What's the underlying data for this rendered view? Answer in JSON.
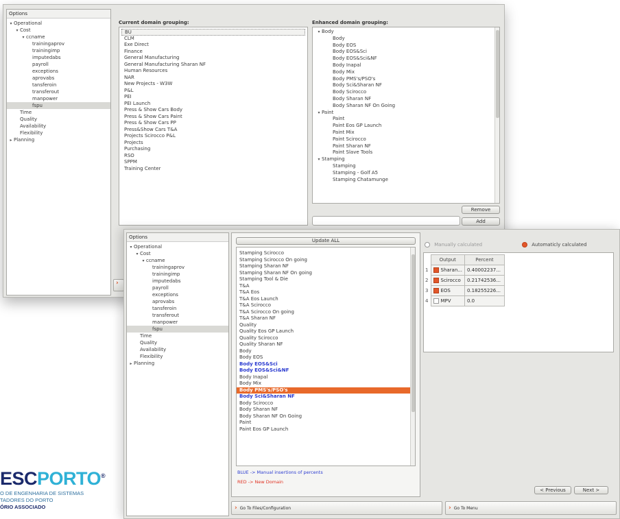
{
  "window_back": {
    "options_label": "Options",
    "tree": [
      {
        "label": "Operational",
        "level": 0,
        "expanded": true
      },
      {
        "label": "Cost",
        "level": 1,
        "expanded": true
      },
      {
        "label": "ccname",
        "level": 2,
        "expanded": true
      },
      {
        "label": "trainingaprov",
        "level": 3
      },
      {
        "label": "trainingimp",
        "level": 3
      },
      {
        "label": "imputedabs",
        "level": 3
      },
      {
        "label": "payroll",
        "level": 3
      },
      {
        "label": "exceptions",
        "level": 3
      },
      {
        "label": "aprovabs",
        "level": 3
      },
      {
        "label": "tansferoin",
        "level": 3
      },
      {
        "label": "transferout",
        "level": 3
      },
      {
        "label": "manpower",
        "level": 3
      },
      {
        "label": "fspu",
        "level": 3,
        "selected": true
      },
      {
        "label": "Time",
        "level": 1
      },
      {
        "label": "Quality",
        "level": 1
      },
      {
        "label": "Availability",
        "level": 1
      },
      {
        "label": "Flexibility",
        "level": 1
      },
      {
        "label": "Planning",
        "level": 0,
        "expanded": false
      }
    ],
    "current_label": "Current domain grouping:",
    "current_items": [
      "BU",
      "CLM",
      "Exe Direct",
      "Finance",
      "General Manufacturing",
      "General Manufacturing Sharan NF",
      "Human Resources",
      "NAR",
      "New Projects - W3W",
      "P&L",
      "PEI",
      "PEI Launch",
      "Press & Show Cars Body",
      "Press & Show Cars Paint",
      "Press & Show Cars PP",
      "Press&Show Cars T&A",
      "Projects Scirocco P&L",
      "Projects",
      "Purchasing",
      "RSO",
      "SPPM",
      "Training Center"
    ],
    "enhanced_label": "Enhanced domain grouping:",
    "enhanced_items": [
      {
        "label": "Body",
        "group": true
      },
      {
        "label": "Body"
      },
      {
        "label": "Body EOS"
      },
      {
        "label": "Body EOS&Sci"
      },
      {
        "label": "Body EOS&Sci&NF"
      },
      {
        "label": "Body Inapal"
      },
      {
        "label": "Body Mix"
      },
      {
        "label": "Body PMS's/PSO's"
      },
      {
        "label": "Body Sci&Sharan NF"
      },
      {
        "label": "Body Scirocco"
      },
      {
        "label": "Body Sharan NF"
      },
      {
        "label": "Body Sharan NF On Going"
      },
      {
        "label": "Paint",
        "group": true
      },
      {
        "label": "Paint"
      },
      {
        "label": "Paint Eos GP Launch"
      },
      {
        "label": "Paint Mix"
      },
      {
        "label": "Paint Scirocco"
      },
      {
        "label": "Paint Sharan NF"
      },
      {
        "label": "Paint Slave Tools"
      },
      {
        "label": "Stamping",
        "group": true
      },
      {
        "label": "Stamping"
      },
      {
        "label": "Stamping - Golf A5"
      },
      {
        "label": "Stamping Chatamunge"
      }
    ],
    "remove_label": "Remove",
    "add_label": "Add"
  },
  "window_front": {
    "options_label": "Options",
    "update_all_label": "Update ALL",
    "domain_items": [
      {
        "label": "Stamping Scirocco"
      },
      {
        "label": "Stamping Scirocco On going"
      },
      {
        "label": "Stamping Sharan NF"
      },
      {
        "label": "Stamping Sharan NF On going"
      },
      {
        "label": "Stamping Tool & Die"
      },
      {
        "label": "T&A"
      },
      {
        "label": "T&A Eos"
      },
      {
        "label": "T&A Eos Launch"
      },
      {
        "label": "T&A Scirocco"
      },
      {
        "label": "T&A Scirocco On going"
      },
      {
        "label": "T&A Sharan NF"
      },
      {
        "label": "Quality"
      },
      {
        "label": "Quality Eos GP Launch"
      },
      {
        "label": "Quality Scirocco"
      },
      {
        "label": "Quality Sharan NF"
      },
      {
        "label": "Body"
      },
      {
        "label": "Body EOS"
      },
      {
        "label": "Body EOS&Sci",
        "style": "blue"
      },
      {
        "label": "Body EOS&Sci&NF",
        "style": "blue"
      },
      {
        "label": "Body Inapal"
      },
      {
        "label": "Body Mix"
      },
      {
        "label": "Body PMS's/PSO's",
        "style": "hl"
      },
      {
        "label": "Body Sci&Sharan NF",
        "style": "blue"
      },
      {
        "label": "Body Scirocco"
      },
      {
        "label": "Body Sharan NF"
      },
      {
        "label": "Body Sharan NF On Going"
      },
      {
        "label": "Paint"
      },
      {
        "label": "Paint Eos GP Launch"
      }
    ],
    "legend_blue": "BLUE -> Manual insertions of percents",
    "legend_red": "RED -> New Domain",
    "manual_label": "Manually calculated",
    "auto_label": "Automaticly calculated",
    "table": {
      "col_output": "Output",
      "col_percent": "Percent",
      "rows": [
        {
          "num": "1",
          "checked": true,
          "output": "Sharan...",
          "percent": "0.40002237..."
        },
        {
          "num": "2",
          "checked": true,
          "output": "Scirocco",
          "percent": "0.21742536..."
        },
        {
          "num": "3",
          "checked": true,
          "output": "EOS",
          "percent": "0.18255226..."
        },
        {
          "num": "4",
          "checked": false,
          "output": "MPV",
          "percent": "0.0"
        }
      ]
    },
    "previous_label": "< Previous",
    "next_label": "Next >",
    "goto_files_label": "Go To Files/Configuration",
    "goto_menu_label": "Go To Menu"
  },
  "logo": {
    "part1": "ESC",
    "part2": "PORTO",
    "registered": "®",
    "line1": "O DE ENGENHARIA DE SISTEMAS",
    "line2": "TADORES DO PORTO",
    "line3": "ÓRIO ASSOCIADO"
  },
  "colors": {
    "highlight": "#e8692a",
    "blue_text": "#2a3ad0",
    "red_text": "#e03020",
    "logo_dark": "#1b2a6b",
    "logo_light": "#2fb1d6"
  }
}
